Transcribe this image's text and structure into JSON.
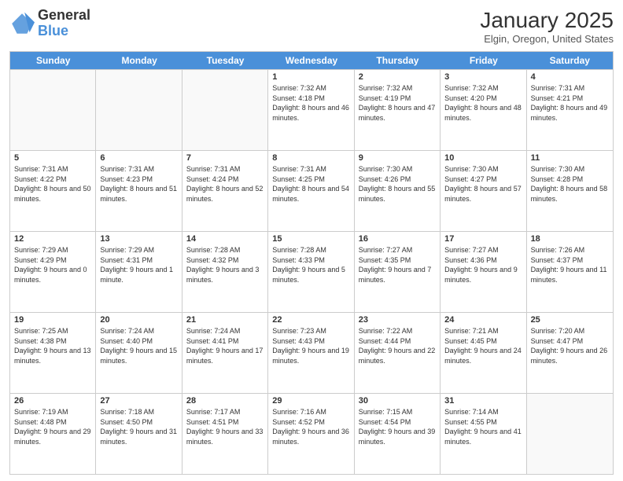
{
  "header": {
    "logo_general": "General",
    "logo_blue": "Blue",
    "month_title": "January 2025",
    "subtitle": "Elgin, Oregon, United States"
  },
  "calendar": {
    "days_of_week": [
      "Sunday",
      "Monday",
      "Tuesday",
      "Wednesday",
      "Thursday",
      "Friday",
      "Saturday"
    ],
    "rows": [
      [
        {
          "day": "",
          "empty": true
        },
        {
          "day": "",
          "empty": true
        },
        {
          "day": "",
          "empty": true
        },
        {
          "day": "1",
          "sunrise": "Sunrise: 7:32 AM",
          "sunset": "Sunset: 4:18 PM",
          "daylight": "Daylight: 8 hours and 46 minutes."
        },
        {
          "day": "2",
          "sunrise": "Sunrise: 7:32 AM",
          "sunset": "Sunset: 4:19 PM",
          "daylight": "Daylight: 8 hours and 47 minutes."
        },
        {
          "day": "3",
          "sunrise": "Sunrise: 7:32 AM",
          "sunset": "Sunset: 4:20 PM",
          "daylight": "Daylight: 8 hours and 48 minutes."
        },
        {
          "day": "4",
          "sunrise": "Sunrise: 7:31 AM",
          "sunset": "Sunset: 4:21 PM",
          "daylight": "Daylight: 8 hours and 49 minutes."
        }
      ],
      [
        {
          "day": "5",
          "sunrise": "Sunrise: 7:31 AM",
          "sunset": "Sunset: 4:22 PM",
          "daylight": "Daylight: 8 hours and 50 minutes."
        },
        {
          "day": "6",
          "sunrise": "Sunrise: 7:31 AM",
          "sunset": "Sunset: 4:23 PM",
          "daylight": "Daylight: 8 hours and 51 minutes."
        },
        {
          "day": "7",
          "sunrise": "Sunrise: 7:31 AM",
          "sunset": "Sunset: 4:24 PM",
          "daylight": "Daylight: 8 hours and 52 minutes."
        },
        {
          "day": "8",
          "sunrise": "Sunrise: 7:31 AM",
          "sunset": "Sunset: 4:25 PM",
          "daylight": "Daylight: 8 hours and 54 minutes."
        },
        {
          "day": "9",
          "sunrise": "Sunrise: 7:30 AM",
          "sunset": "Sunset: 4:26 PM",
          "daylight": "Daylight: 8 hours and 55 minutes."
        },
        {
          "day": "10",
          "sunrise": "Sunrise: 7:30 AM",
          "sunset": "Sunset: 4:27 PM",
          "daylight": "Daylight: 8 hours and 57 minutes."
        },
        {
          "day": "11",
          "sunrise": "Sunrise: 7:30 AM",
          "sunset": "Sunset: 4:28 PM",
          "daylight": "Daylight: 8 hours and 58 minutes."
        }
      ],
      [
        {
          "day": "12",
          "sunrise": "Sunrise: 7:29 AM",
          "sunset": "Sunset: 4:29 PM",
          "daylight": "Daylight: 9 hours and 0 minutes."
        },
        {
          "day": "13",
          "sunrise": "Sunrise: 7:29 AM",
          "sunset": "Sunset: 4:31 PM",
          "daylight": "Daylight: 9 hours and 1 minute."
        },
        {
          "day": "14",
          "sunrise": "Sunrise: 7:28 AM",
          "sunset": "Sunset: 4:32 PM",
          "daylight": "Daylight: 9 hours and 3 minutes."
        },
        {
          "day": "15",
          "sunrise": "Sunrise: 7:28 AM",
          "sunset": "Sunset: 4:33 PM",
          "daylight": "Daylight: 9 hours and 5 minutes."
        },
        {
          "day": "16",
          "sunrise": "Sunrise: 7:27 AM",
          "sunset": "Sunset: 4:35 PM",
          "daylight": "Daylight: 9 hours and 7 minutes."
        },
        {
          "day": "17",
          "sunrise": "Sunrise: 7:27 AM",
          "sunset": "Sunset: 4:36 PM",
          "daylight": "Daylight: 9 hours and 9 minutes."
        },
        {
          "day": "18",
          "sunrise": "Sunrise: 7:26 AM",
          "sunset": "Sunset: 4:37 PM",
          "daylight": "Daylight: 9 hours and 11 minutes."
        }
      ],
      [
        {
          "day": "19",
          "sunrise": "Sunrise: 7:25 AM",
          "sunset": "Sunset: 4:38 PM",
          "daylight": "Daylight: 9 hours and 13 minutes."
        },
        {
          "day": "20",
          "sunrise": "Sunrise: 7:24 AM",
          "sunset": "Sunset: 4:40 PM",
          "daylight": "Daylight: 9 hours and 15 minutes."
        },
        {
          "day": "21",
          "sunrise": "Sunrise: 7:24 AM",
          "sunset": "Sunset: 4:41 PM",
          "daylight": "Daylight: 9 hours and 17 minutes."
        },
        {
          "day": "22",
          "sunrise": "Sunrise: 7:23 AM",
          "sunset": "Sunset: 4:43 PM",
          "daylight": "Daylight: 9 hours and 19 minutes."
        },
        {
          "day": "23",
          "sunrise": "Sunrise: 7:22 AM",
          "sunset": "Sunset: 4:44 PM",
          "daylight": "Daylight: 9 hours and 22 minutes."
        },
        {
          "day": "24",
          "sunrise": "Sunrise: 7:21 AM",
          "sunset": "Sunset: 4:45 PM",
          "daylight": "Daylight: 9 hours and 24 minutes."
        },
        {
          "day": "25",
          "sunrise": "Sunrise: 7:20 AM",
          "sunset": "Sunset: 4:47 PM",
          "daylight": "Daylight: 9 hours and 26 minutes."
        }
      ],
      [
        {
          "day": "26",
          "sunrise": "Sunrise: 7:19 AM",
          "sunset": "Sunset: 4:48 PM",
          "daylight": "Daylight: 9 hours and 29 minutes."
        },
        {
          "day": "27",
          "sunrise": "Sunrise: 7:18 AM",
          "sunset": "Sunset: 4:50 PM",
          "daylight": "Daylight: 9 hours and 31 minutes."
        },
        {
          "day": "28",
          "sunrise": "Sunrise: 7:17 AM",
          "sunset": "Sunset: 4:51 PM",
          "daylight": "Daylight: 9 hours and 33 minutes."
        },
        {
          "day": "29",
          "sunrise": "Sunrise: 7:16 AM",
          "sunset": "Sunset: 4:52 PM",
          "daylight": "Daylight: 9 hours and 36 minutes."
        },
        {
          "day": "30",
          "sunrise": "Sunrise: 7:15 AM",
          "sunset": "Sunset: 4:54 PM",
          "daylight": "Daylight: 9 hours and 39 minutes."
        },
        {
          "day": "31",
          "sunrise": "Sunrise: 7:14 AM",
          "sunset": "Sunset: 4:55 PM",
          "daylight": "Daylight: 9 hours and 41 minutes."
        },
        {
          "day": "",
          "empty": true
        }
      ]
    ]
  }
}
